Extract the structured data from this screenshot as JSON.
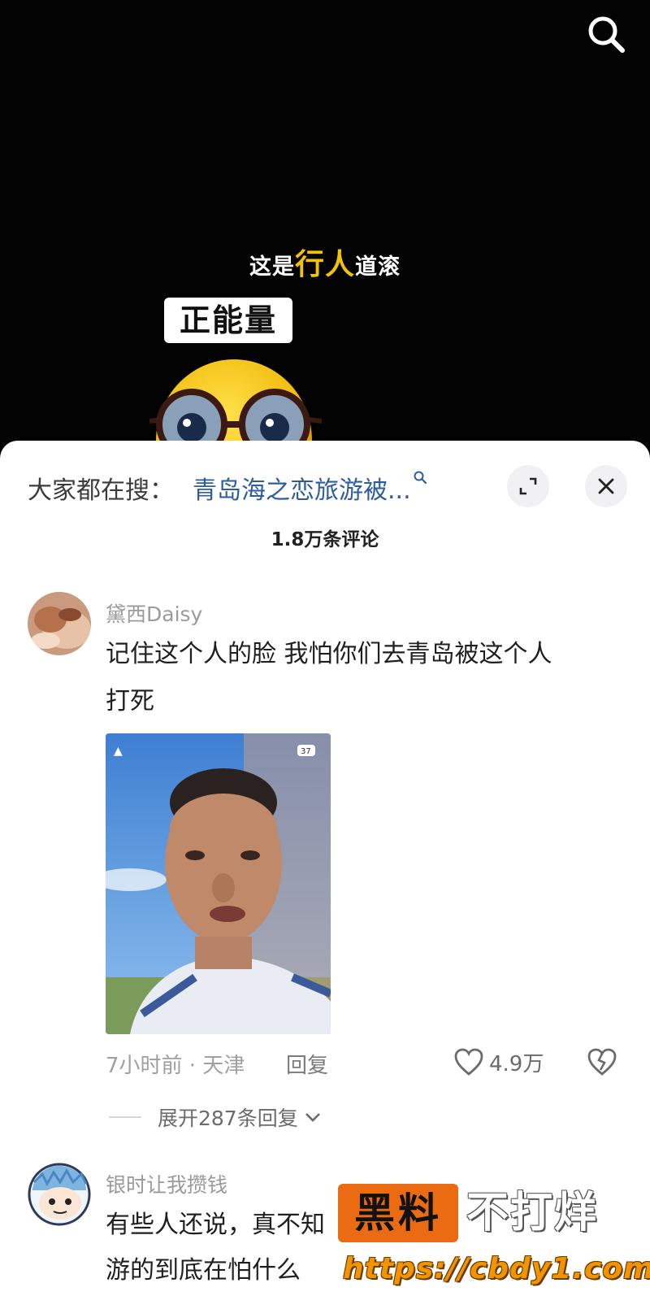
{
  "video": {
    "caption_pre": "这是",
    "caption_highlight": "行人",
    "caption_post": "道滚",
    "badge": "正能量",
    "highlight_color": "#f2c300"
  },
  "sheet": {
    "hot_prefix": "大家都在搜：",
    "hot_query": "青岛海之恋旅游被...",
    "comment_count": "1.8万条评论",
    "link_color": "#2d5d9c"
  },
  "icons": {
    "search": "search-icon",
    "expand": "expand-icon",
    "close": "close-icon",
    "like": "heart-icon",
    "dislike": "broken-heart-icon"
  },
  "comments": [
    {
      "username": "黛西Daisy",
      "text_line1": "记住这个人的脸  我怕你们去青岛被这个人",
      "text_line2": "打死",
      "time_location": "7小时前 · 天津",
      "reply_label": "回复",
      "likes": "4.9万",
      "expand_label": "展开287条回复",
      "photo_status_battery": "37"
    },
    {
      "username": "银时让我攒钱",
      "text_line1": "有些人还说，真不知",
      "text_line2": "游的到底在怕什么"
    }
  ],
  "watermark": {
    "box": "黑料",
    "words": "不打烊",
    "url": "https://cbdy1.com"
  }
}
